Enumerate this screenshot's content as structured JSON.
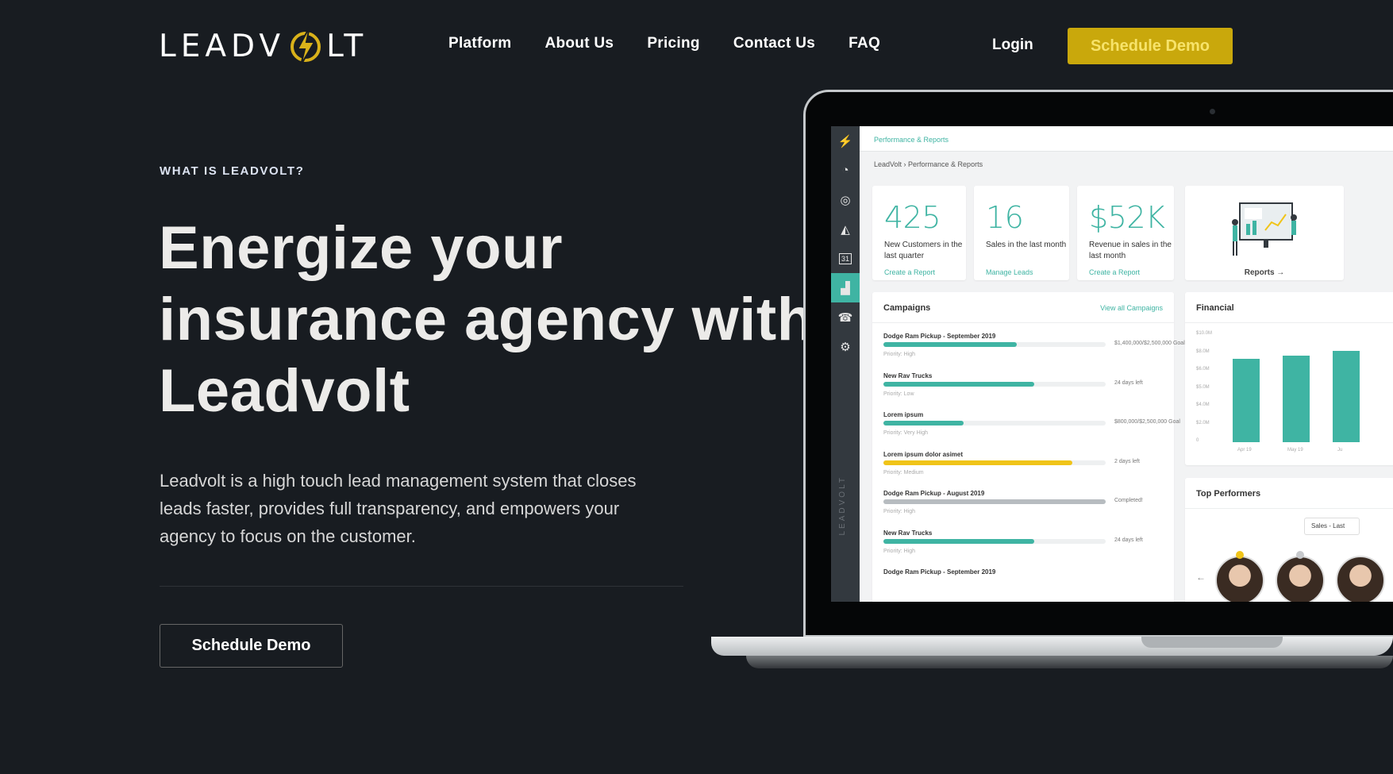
{
  "header": {
    "logo_left": "LEADV",
    "logo_right": "LT",
    "nav": [
      "Platform",
      "About Us",
      "Pricing",
      "Contact Us",
      "FAQ"
    ],
    "login": "Login",
    "cta": "Schedule Demo"
  },
  "hero": {
    "eyebrow": "WHAT IS LEADVOLT?",
    "headline": "Energize your insurance agency with Leadvolt",
    "description": "Leadvolt is a high touch lead management system that closes leads faster, provides full transparency, and empowers your agency to focus on the customer.",
    "cta": "Schedule Demo"
  },
  "colors": {
    "background": "#181c21",
    "accent": "#c9a80c",
    "teal": "#3fb4a3"
  },
  "dashboard": {
    "title": "Performance & Reports",
    "breadcrumb": "LeadVolt  ›  Performance & Reports",
    "brand_vertical": "LEADVOLT",
    "sidebar_icons": [
      "bolt-icon",
      "dashboard-icon",
      "target-icon",
      "megaphone-icon",
      "calendar-icon",
      "chart-icon",
      "phone-icon",
      "settings-icon"
    ],
    "calendar_day": "31",
    "kpis": [
      {
        "value": "425",
        "label": "New Customers in the last quarter",
        "link": "Create a Report"
      },
      {
        "value": "16",
        "label": "Sales in the last month",
        "link": "Manage Leads"
      },
      {
        "value": "$52K",
        "label": "Revenue in sales in the last month",
        "link": "Create a Report"
      }
    ],
    "reports_label": "Reports →",
    "campaigns": {
      "title": "Campaigns",
      "link": "View all Campaigns",
      "rows": [
        {
          "name": "Dodge Ram Pickup - September 2019",
          "progress": 0.6,
          "color": "#3fb4a3",
          "meta": "$1,400,000/$2,500,000 Goal",
          "priority": "Priority: High"
        },
        {
          "name": "New Rav Trucks",
          "progress": 0.68,
          "color": "#3fb4a3",
          "meta": "24 days left",
          "priority": "Priority: Low"
        },
        {
          "name": "Lorem ipsum",
          "progress": 0.36,
          "color": "#3fb4a3",
          "meta": "$800,000/$2,500,000 Goal",
          "priority": "Priority: Very High"
        },
        {
          "name": "Lorem ipsum dolor asimet",
          "progress": 0.85,
          "color": "#f0c419",
          "meta": "2 days left",
          "priority": "Priority: Medium"
        },
        {
          "name": "Dodge Ram Pickup - August 2019",
          "progress": 1.0,
          "color": "#b7bcc0",
          "meta": "Completed!",
          "priority": "Priority: High"
        },
        {
          "name": "New Rav Trucks",
          "progress": 0.68,
          "color": "#3fb4a3",
          "meta": "24 days left",
          "priority": "Priority: High"
        },
        {
          "name": "Dodge Ram Pickup - September 2019",
          "progress": 0,
          "color": "#3fb4a3",
          "meta": "",
          "priority": ""
        }
      ]
    },
    "financial": {
      "title": "Financial",
      "axis": [
        "$10.0M",
        "$8.0M",
        "$6.0M",
        "$5.0M",
        "$4.0M",
        "$2.0M",
        "0"
      ],
      "months": [
        "Apr 19",
        "May 19",
        "Ju"
      ],
      "values": [
        7.8,
        8.1,
        8.5
      ]
    },
    "top_performers": {
      "title": "Top Performers",
      "select": "Sales - Last"
    }
  }
}
